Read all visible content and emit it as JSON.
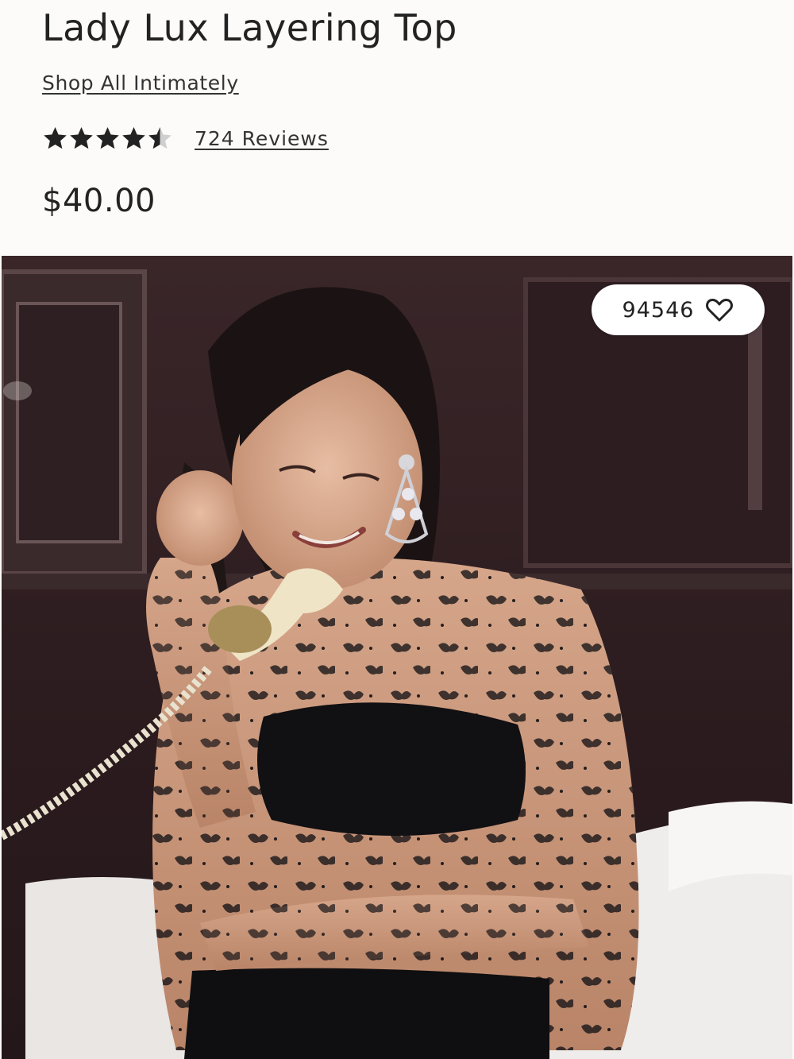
{
  "product": {
    "title": "Lady Lux Layering Top",
    "shop_link": "Shop All Intimately",
    "rating": 4.5,
    "rating_max": 5,
    "reviews_label": "724 Reviews",
    "price": "$40.00"
  },
  "favorite": {
    "count": "94546",
    "icon": "heart-outline-icon"
  },
  "image": {
    "subject": "product-photo"
  },
  "colors": {
    "background": "#fcfbf9",
    "text": "#222222",
    "star": "#222222",
    "star_empty": "#cfcfcf"
  }
}
